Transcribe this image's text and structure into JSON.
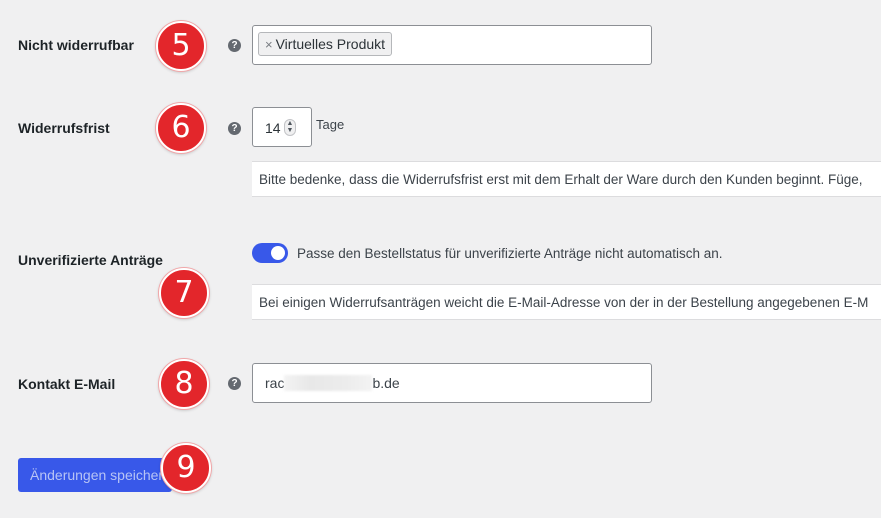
{
  "fields": {
    "nicht_widerrufbar": {
      "label": "Nicht widerrufbar",
      "help": "?",
      "chip_remove": "×",
      "chip_label": "Virtuelles Produkt"
    },
    "widerrufsfrist": {
      "label": "Widerrufsfrist",
      "help": "?",
      "value": "14",
      "spin_up": "▲",
      "spin_down": "▼",
      "unit": "Tage",
      "description": "Bitte bedenke, dass die Widerrufsfrist erst mit dem Erhalt der Ware durch den Kunden beginnt. Füge,"
    },
    "unverifizierte_antraege": {
      "label": "Unverifizierte Anträge",
      "toggle_on": true,
      "toggle_label": "Passe den Bestellstatus für unverifizierte Anträge nicht automatisch an.",
      "description": "Bei einigen Widerrufsanträgen weicht die E-Mail-Adresse von der in der Bestellung angegebenen E-M"
    },
    "kontakt_email": {
      "label": "Kontakt E-Mail",
      "help": "?",
      "value_start": "rac",
      "value_end": "b.de"
    }
  },
  "save_button": {
    "label": "Änderungen speichern"
  },
  "markers": [
    "5",
    "6",
    "7",
    "8",
    "9"
  ],
  "colors": {
    "accent": "#3858e9",
    "marker": "#e3262b",
    "background": "#f0f0f1"
  },
  "icons": {
    "help": "help-icon",
    "remove": "close-icon",
    "spinner": "number-spinner-icon"
  }
}
